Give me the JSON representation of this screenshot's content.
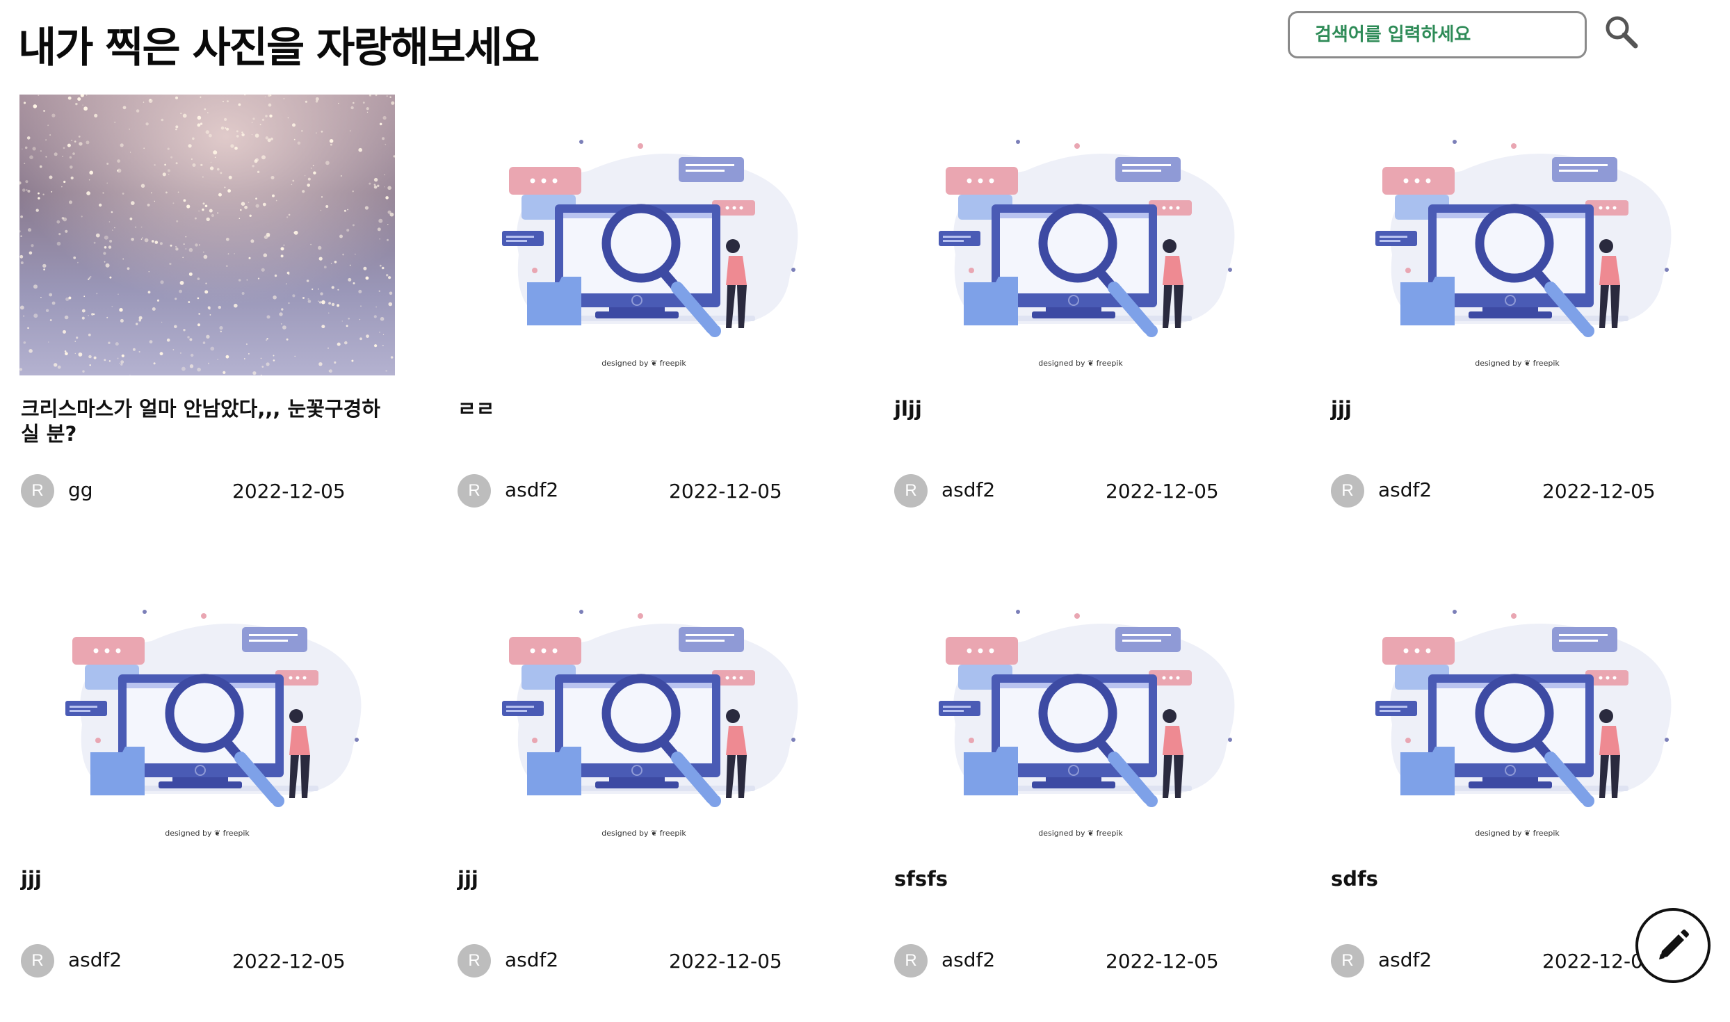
{
  "header": {
    "title": "내가 찍은 사진을 자랑해보세요",
    "search_placeholder": "검색어를 입력하세요",
    "search_icon": "search-icon"
  },
  "posts": [
    {
      "title": "크리스마스가 얼마 안남았다,,, 눈꽃구경하실 분?",
      "avatar": "R",
      "author": "gg",
      "date": "2022-12-05",
      "image": "snow-photo"
    },
    {
      "title": "ㄹㄹ",
      "avatar": "R",
      "author": "asdf2",
      "date": "2022-12-05",
      "image": "search-illustration"
    },
    {
      "title": "jljj",
      "avatar": "R",
      "author": "asdf2",
      "date": "2022-12-05",
      "image": "search-illustration"
    },
    {
      "title": "jjj",
      "avatar": "R",
      "author": "asdf2",
      "date": "2022-12-05",
      "image": "search-illustration"
    },
    {
      "title": "jjj",
      "avatar": "R",
      "author": "asdf2",
      "date": "2022-12-05",
      "image": "search-illustration"
    },
    {
      "title": "jjj",
      "avatar": "R",
      "author": "asdf2",
      "date": "2022-12-05",
      "image": "search-illustration"
    },
    {
      "title": "sfsfs",
      "avatar": "R",
      "author": "asdf2",
      "date": "2022-12-05",
      "image": "search-illustration"
    },
    {
      "title": "sdfs",
      "avatar": "R",
      "author": "asdf2",
      "date": "2022-12-05",
      "image": "search-illustration"
    }
  ],
  "illustration": {
    "credit": "designed by ❦ freepik"
  },
  "fab": {
    "icon": "pencil-icon"
  },
  "colors": {
    "search_text": "#2e8b57",
    "avatar_bg": "#bdbdbd",
    "monitor": "#4a5bb5",
    "accent_pink": "#e9a6b2",
    "accent_blue": "#7ea1e8"
  }
}
